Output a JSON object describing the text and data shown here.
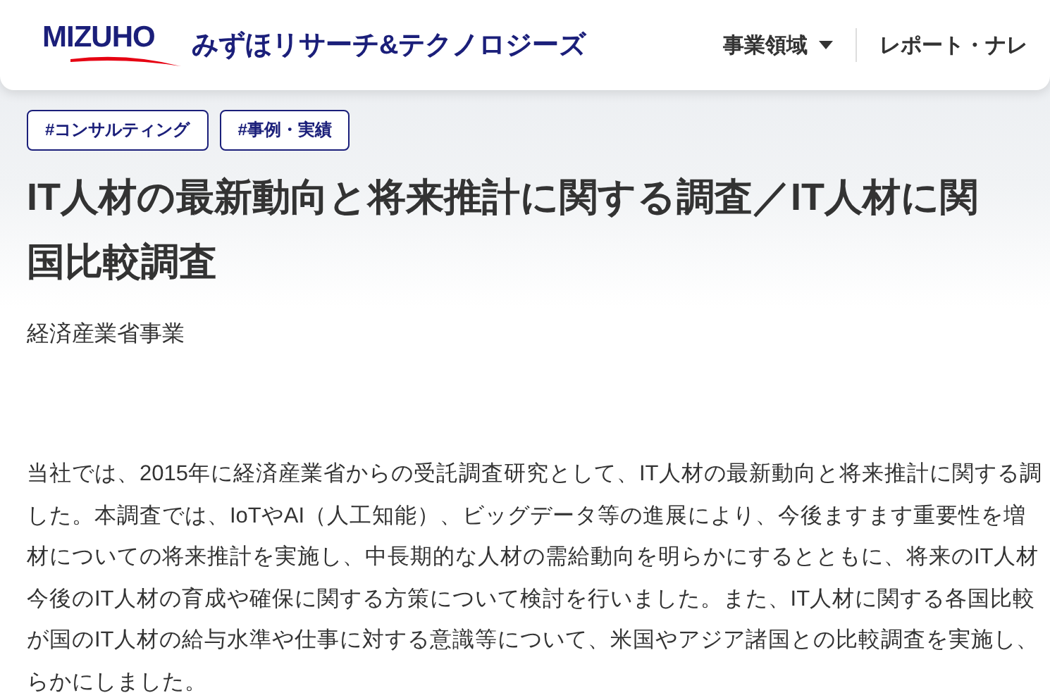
{
  "header": {
    "logo_text": "MIZUHO",
    "company_name": "みずほリサーチ&テクノロジーズ",
    "nav": [
      {
        "label": "事業領域",
        "kind": "dropdown"
      },
      {
        "label": "レポート・ナレ",
        "kind": "link"
      }
    ]
  },
  "tags": [
    "#コンサルティング",
    "#事例・実績"
  ],
  "title_lines": [
    "IT人材の最新動向と将来推計に関する調査／IT人材に関",
    "国比較調査"
  ],
  "subtitle": "経済産業省事業",
  "body_lines": [
    "当社では、2015年に経済産業省からの受託調査研究として、IT人材の最新動向と将来推計に関する調",
    "した。本調査では、IoTやAI（人工知能）、ビッグデータ等の進展により、今後ますます重要性を増",
    "材についての将来推計を実施し、中長期的な人材の需給動向を明らかにするとともに、将来のIT人材",
    "今後のIT人材の育成や確保に関する方策について検討を行いました。また、IT人材に関する各国比較",
    "が国のIT人材の給与水準や仕事に対する意識等について、米国やアジア諸国との比較調査を実施し、",
    "らかにしました。"
  ]
}
